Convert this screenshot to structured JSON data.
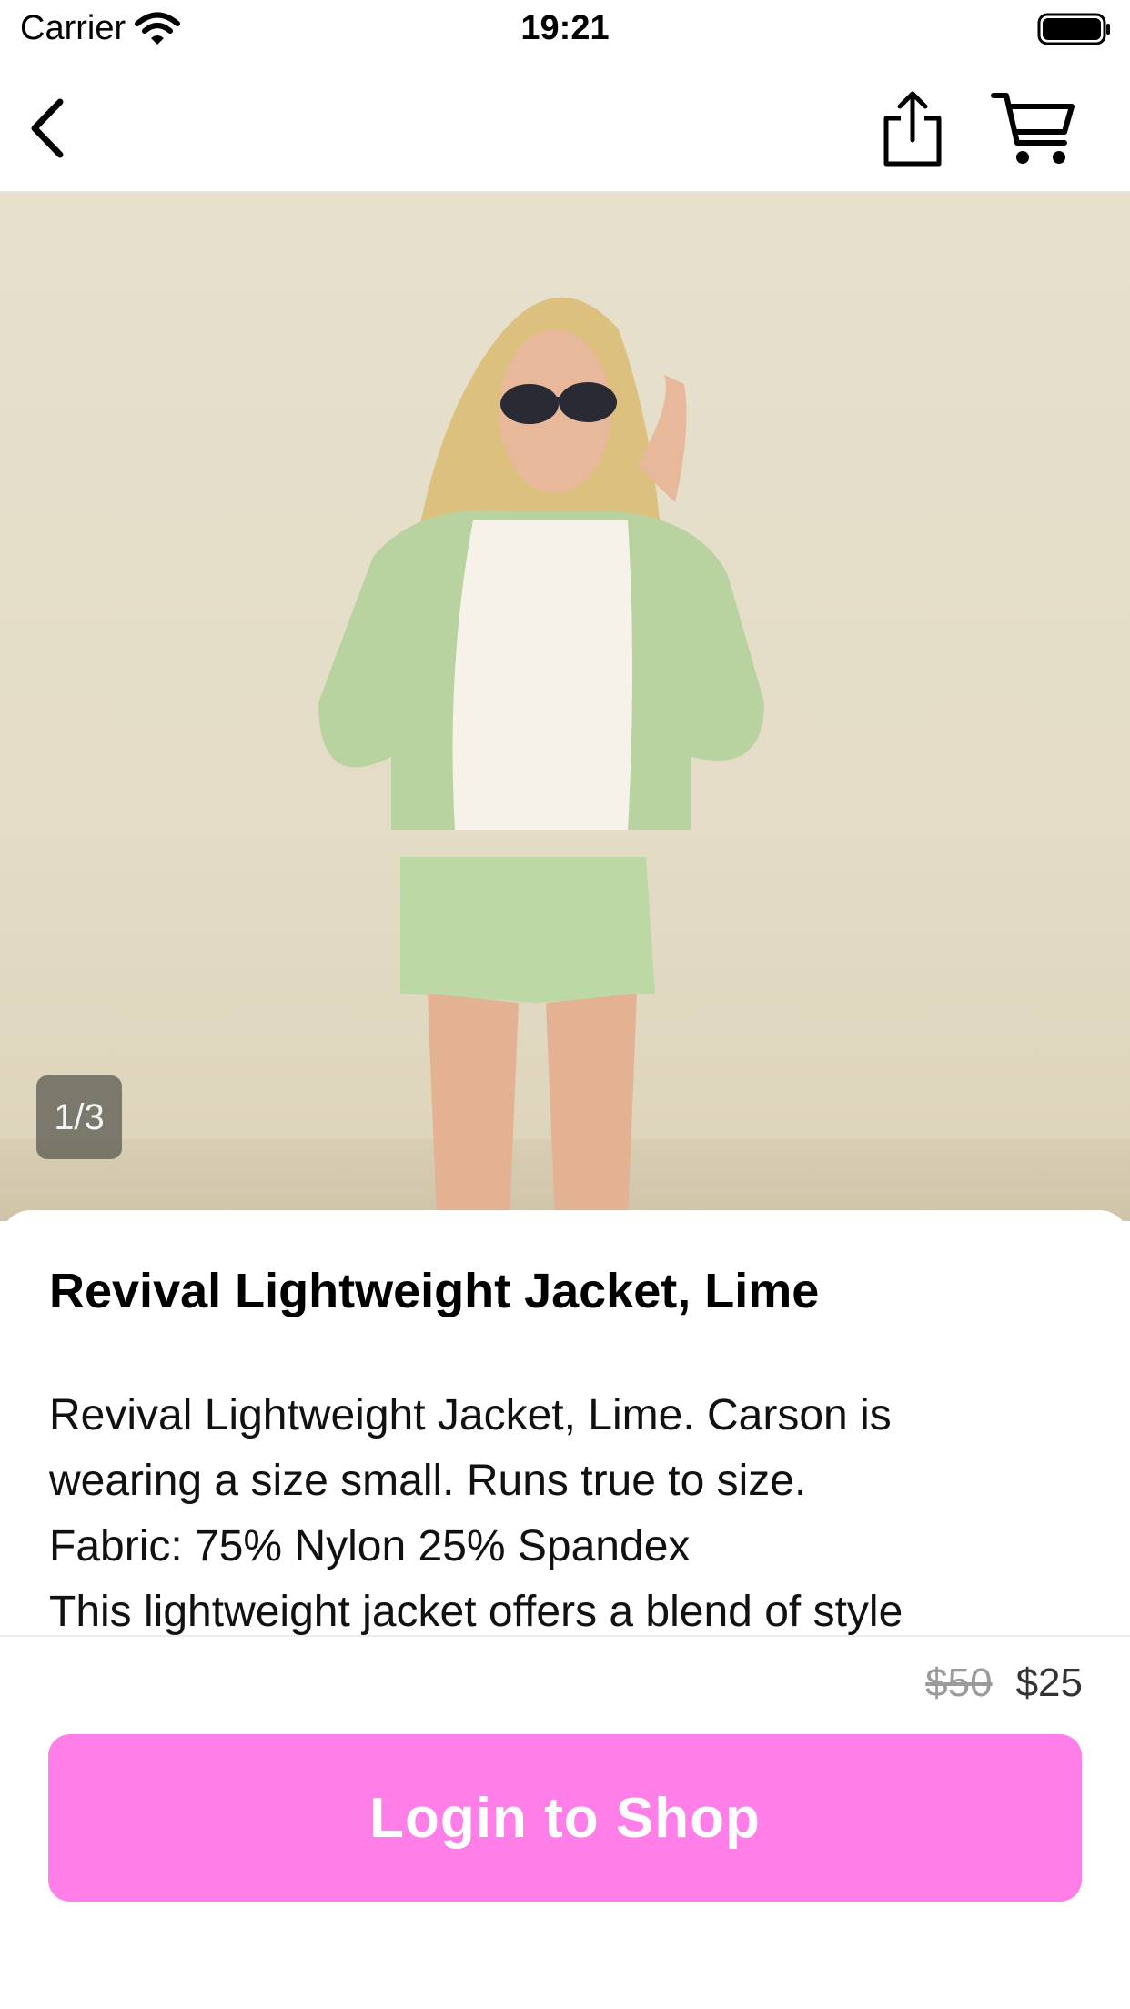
{
  "status_bar": {
    "carrier": "Carrier",
    "time": "19:21"
  },
  "nav": {
    "back_icon": "chevron-left-icon",
    "share_icon": "share-icon",
    "cart_icon": "cart-icon"
  },
  "gallery": {
    "counter": "1/3"
  },
  "product": {
    "title": "Revival Lightweight Jacket, Lime",
    "description_lines": [
      "Revival Lightweight Jacket, Lime. Carson is",
      "wearing a size small. Runs true to size.",
      "Fabric: 75% Nylon 25% Spandex",
      "This lightweight jacket offers a blend of style"
    ]
  },
  "pricing": {
    "original": "$50",
    "sale": "$25"
  },
  "cta": {
    "label": "Login to Shop",
    "color": "#ff7ee8"
  }
}
